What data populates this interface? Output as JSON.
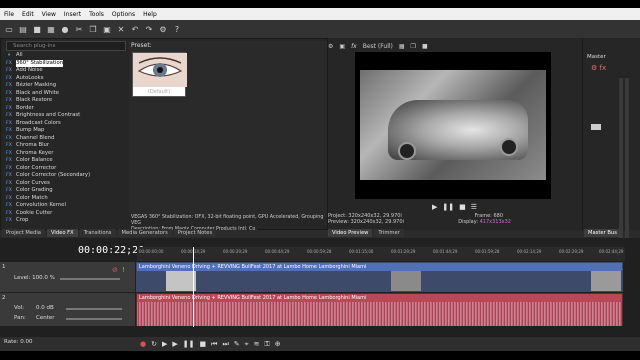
{
  "menu": [
    "File",
    "Edit",
    "View",
    "Insert",
    "Tools",
    "Options",
    "Help"
  ],
  "plugins": {
    "search_placeholder": "Search plug-ins",
    "root": "All",
    "items": [
      "360° Stabilization",
      "Add Noise",
      "AutoLooks",
      "Bézier Masking",
      "Black and White",
      "Black Restore",
      "Border",
      "Brightness and Contrast",
      "Broadcast Colors",
      "Bump Map",
      "Channel Blend",
      "Chroma Blur",
      "Chroma Keyer",
      "Color Balance",
      "Color Corrector",
      "Color Corrector (Secondary)",
      "Color Curves",
      "Color Grading",
      "Color Match",
      "Convolution Kernel",
      "Cookie Cutter",
      "Crop"
    ],
    "selected": "360° Stabilization"
  },
  "preset": {
    "label": "Preset:",
    "thumb_label": "(Default)",
    "description_line1": "VEGAS 360° Stabilization: OFX, 32-bit floating point, GPU Accelerated, Grouping VEG",
    "description_line2": "Description: From Magix Computer Products Intl. Co."
  },
  "left_tabs": [
    "Project Media",
    "Video FX",
    "Transitions",
    "Media Generators",
    "Project Notes"
  ],
  "preview": {
    "quality": "Best (Full)",
    "project_label": "Project:",
    "project_value": "320x240x32, 29.970i",
    "preview_label": "Preview:",
    "preview_value": "320x240x32, 29.970i",
    "frame_label": "Frame:",
    "frame_value": "680",
    "display_label": "Display:",
    "display_value": "417x313x32",
    "tabs": [
      "Video Preview",
      "Trimmer"
    ]
  },
  "master": {
    "label": "Master",
    "tab": "Master Bus"
  },
  "timeline": {
    "timecode": "00:00:22;20",
    "ruler_labels": [
      "00:00:00;00",
      "00:00:14;29",
      "00:00:29;29",
      "00:00:44;29",
      "00:00:59;28",
      "00:01:15;00",
      "00:01:29;29",
      "00:01:44;29",
      "00:01:59;28",
      "00:02:14;29",
      "00:02:29;29",
      "00:02:44;29"
    ],
    "video_level": "Level: 100.0 %",
    "video_clip": "Lamborghini Veneno Driving + REVVING BullFest 2017 at Lambo Home Lamborghini Miami",
    "audio_clip": "Lamborghini Veneno Driving + REVVING BullFest 2017 at Lambo Home Lamborghini Miami",
    "vol_label": "Vol:",
    "vol_value": "0.0 dB",
    "pan_label": "Pan:",
    "pan_value": "Center",
    "rate": "Rate: 0.00",
    "track_numbers": [
      "1",
      "2"
    ]
  }
}
